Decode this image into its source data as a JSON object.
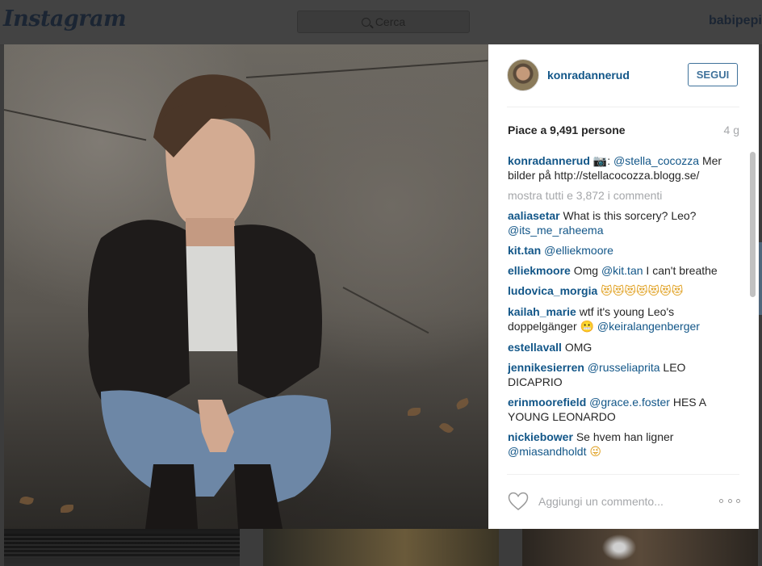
{
  "app": {
    "logo": "Instagram"
  },
  "search": {
    "placeholder": "Cerca"
  },
  "header": {
    "username": "babipepi"
  },
  "post": {
    "author": "konradannerud",
    "follow_label": "SEGUI",
    "likes": "Piace a 9,491 persone",
    "age": "4 g",
    "caption": {
      "user": "konradannerud",
      "camera": "📷",
      "colon": ":",
      "mention": "@stella_cocozza",
      "text": "Mer bilder på http://stellacocozza.blogg.se/"
    },
    "load_more": "mostra tutti e 3,872 i commenti",
    "comments": [
      {
        "user": "aaliasetar",
        "text": "What is this sorcery? Leo?",
        "mention": "@its_me_raheema"
      },
      {
        "user": "kit.tan",
        "text": "",
        "mention": "@elliekmoore"
      },
      {
        "user": "elliekmoore",
        "text": "Omg",
        "mention": "@kit.tan",
        "after": "I can't breathe"
      },
      {
        "user": "ludovica_morgia",
        "emoji": "😻😻😻😻😻😻😻"
      },
      {
        "user": "kailah_marie",
        "text": "wtf it's young Leo's doppelgänger",
        "emoji": "😬",
        "mention": "@keiralangenberger"
      },
      {
        "user": "estellavall",
        "text": "OMG"
      },
      {
        "user": "jennikesierren",
        "mention": "@russeliaprita",
        "after": "LEO DICAPRIO"
      },
      {
        "user": "erinmoorefield",
        "mention": "@grace.e.foster",
        "after": "HES A YOUNG LEONARDO"
      },
      {
        "user": "nickiebower",
        "text": "Se hvem han ligner",
        "mention": "@miasandholdt",
        "emoji": "😜"
      }
    ],
    "comment_placeholder": "Aggiungi un commento..."
  },
  "colors": {
    "link": "#125688",
    "button": "#3f729b",
    "muted": "#a5a7aa",
    "overlay": "#3c3c3c"
  },
  "icons": {
    "heart": "heart-icon",
    "more": "more-options-icon",
    "search": "search-icon"
  }
}
